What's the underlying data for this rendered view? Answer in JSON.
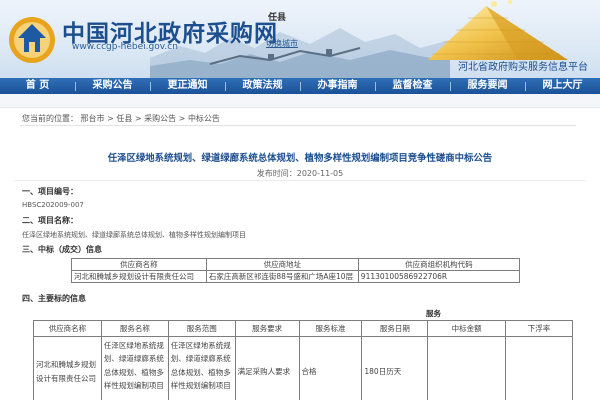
{
  "header": {
    "site_title": "中国河北政府采购网",
    "site_url": "www.ccgp-hebei.gov.cn",
    "small_label": "任县",
    "small_link": "切换城市",
    "tagline": "河北省政府购买服务信息平台"
  },
  "nav": {
    "items": [
      "首 页",
      "采购公告",
      "更正通知",
      "政策法规",
      "办事指南",
      "监督检查",
      "服务要闻",
      "网上大厅"
    ]
  },
  "breadcrumb": {
    "prefix": "您当前的位置",
    "items": [
      "邢台市",
      "任县",
      "采购公告",
      "中标公告"
    ],
    "sep": " > "
  },
  "article": {
    "title": "任泽区绿地系统规划、绿道绿廊系统总体规划、植物多样性规划编制项目竞争性磋商中标公告",
    "pubdate": "发布时间：2020-11-05",
    "s1_title": "一、项目编号：",
    "s1_value": "HBSC202009-007",
    "s2_title": "二、项目名称：",
    "s2_value": "任泽区绿地系统规划、绿道绿廊系统总体规划、植物多样性规划编制项目",
    "s3_title": "三、中标（成交）信息",
    "s4_title": "四、主要标的信息",
    "service_label": "服务"
  },
  "winner_table": {
    "headers": [
      "供应商名称",
      "供应商地址",
      "供应商组织机构代码"
    ],
    "rows": [
      [
        "河北和腾城乡规划设计有限责任公司",
        "石家庄高新区祁连街88号盛和广场A座10层",
        "91130100586922706R"
      ]
    ]
  },
  "service_table": {
    "headers": [
      "供应商名称",
      "服务名称",
      "服务范围",
      "服务要求",
      "服务标准",
      "服务日期",
      "中标金额",
      "下浮率"
    ],
    "rows": [
      [
        "河北和腾城乡规划设计有限责任公司",
        "任泽区绿地系统规划、绿道绿廊系统总体规划、植物多样性规划编制项目",
        "任泽区绿地系统规划、绿道绿廊系统总体规划、植物多样性规划编制项目",
        "满足采购人要求",
        "合格",
        "180日历天",
        "",
        ""
      ]
    ]
  },
  "colors": {
    "nav_blue": "#1b5198",
    "title_blue": "#1d4f8f",
    "link_blue": "#2a5d97"
  }
}
